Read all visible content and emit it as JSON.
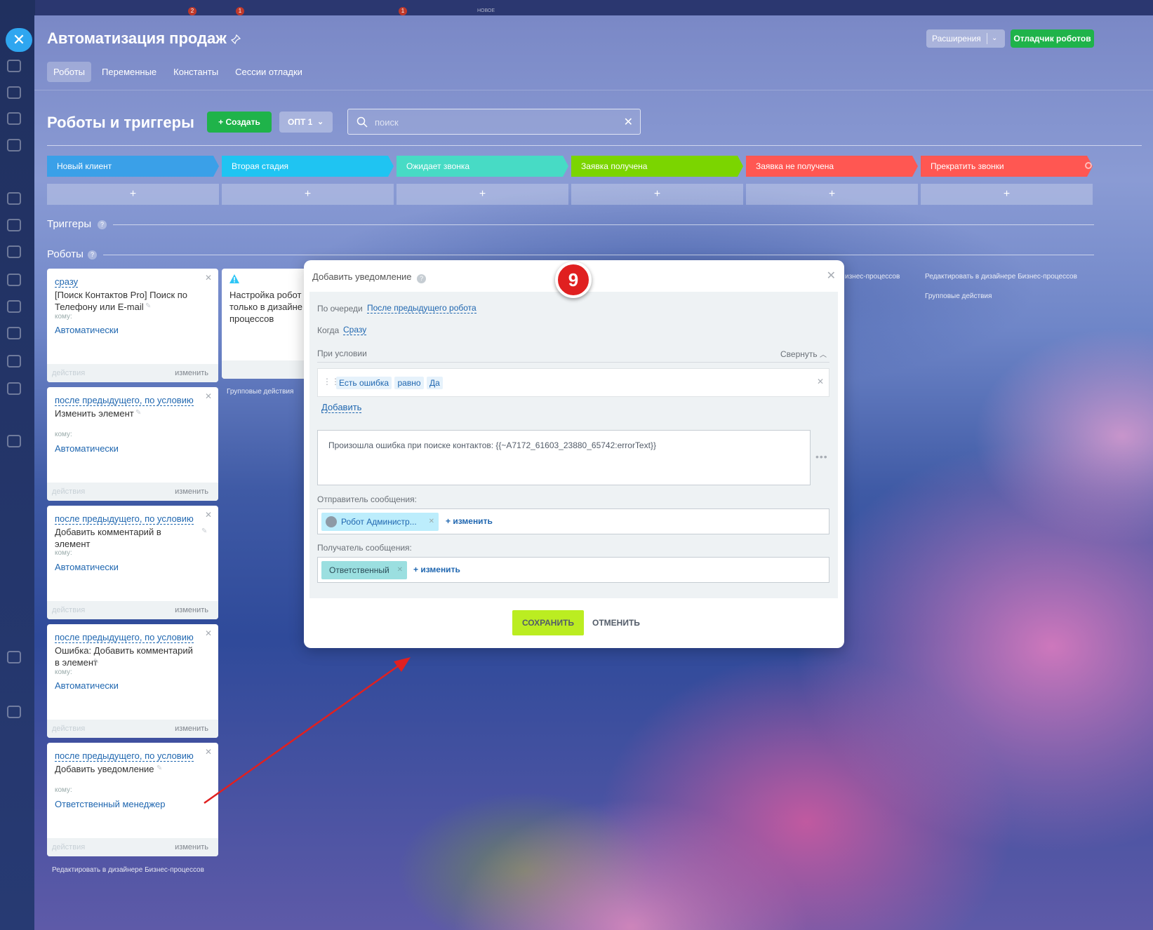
{
  "window": {
    "title": "Автоматизация продаж",
    "tabs": [
      {
        "label": "Роботы",
        "active": true
      },
      {
        "label": "Переменные",
        "active": false
      },
      {
        "label": "Константы",
        "active": false
      },
      {
        "label": "Сессии отладки",
        "active": false
      }
    ],
    "extensions_label": "Расширения",
    "debugger_label": "Отладчик роботов"
  },
  "toolbar": {
    "section_title": "Роботы и триггеры",
    "create_label": "Создать",
    "opt_label": "ОПТ 1",
    "search_placeholder": "поиск"
  },
  "stages": [
    {
      "label": "Новый клиент",
      "color": "#3aa0e8"
    },
    {
      "label": "Вторая стадия",
      "color": "#1fc4f2"
    },
    {
      "label": "Ожидает звонка",
      "color": "#47dbc5"
    },
    {
      "label": "Заявка получена",
      "color": "#7bd500"
    },
    {
      "label": "Заявка не получена",
      "color": "#ff5752"
    },
    {
      "label": "Прекратить звонки",
      "color": "#ff5752"
    }
  ],
  "plus_label": "+",
  "sections": {
    "triggers": "Триггеры",
    "robots": "Роботы",
    "help": "?"
  },
  "robot_cards": [
    {
      "when": "сразу",
      "name": "[Поиск Контактов Pro] Поиск по Телефону или E-mail",
      "komu": "кому:",
      "target": "Автоматически",
      "actions": "действия",
      "edit": "изменить"
    },
    {
      "when": "после предыдущего, по условию",
      "name": "Изменить элемент",
      "komu": "кому:",
      "target": "Автоматически",
      "actions": "действия",
      "edit": "изменить"
    },
    {
      "when": "после предыдущего, по условию",
      "name": "Добавить комментарий в элемент",
      "komu": "кому:",
      "target": "Автоматически",
      "actions": "действия",
      "edit": "изменить"
    },
    {
      "when": "после предыдущего, по условию",
      "name": "Ошибка: Добавить комментарий в элемент",
      "komu": "кому:",
      "target": "Автоматически",
      "actions": "действия",
      "edit": "изменить"
    },
    {
      "when": "после предыдущего, по условию",
      "name": "Добавить уведомление",
      "komu": "кому:",
      "target": "Ответственный менеджер",
      "actions": "действия",
      "edit": "изменить"
    }
  ],
  "second_card": {
    "text": "Настройка робот только в дизайне процессов"
  },
  "footer_links": {
    "edit_designer": "Редактировать в дизайнере Бизнес-процессов",
    "group_actions": "Групповые действия",
    "biz_processes_fragment": "изнес-процессов"
  },
  "popup": {
    "title": "Добавить уведомление",
    "queue_label": "По очереди",
    "queue_value": "После предыдущего робота",
    "when_label": "Когда",
    "when_value": "Сразу",
    "condition_label": "При условии",
    "collapse_label": "Свернуть",
    "condition": {
      "field": "Есть ошибка",
      "op": "равно",
      "value": "Да"
    },
    "add_label": "Добавить",
    "message": "Произошла ошибка при поиске контактов: {{~A7172_61603_23880_65742:errorText}}",
    "sender_label": "Отправитель сообщения:",
    "sender_value": "Робот Администр...",
    "recipient_label": "Получатель сообщения:",
    "recipient_value": "Ответственный",
    "change_label": "изменить",
    "save_label": "СОХРАНИТЬ",
    "cancel_label": "ОТМЕНИТЬ"
  },
  "annotation": {
    "step": "9"
  },
  "topbar_badges": [
    "2",
    "1",
    "1"
  ],
  "topbar_new": "НОВОЕ"
}
